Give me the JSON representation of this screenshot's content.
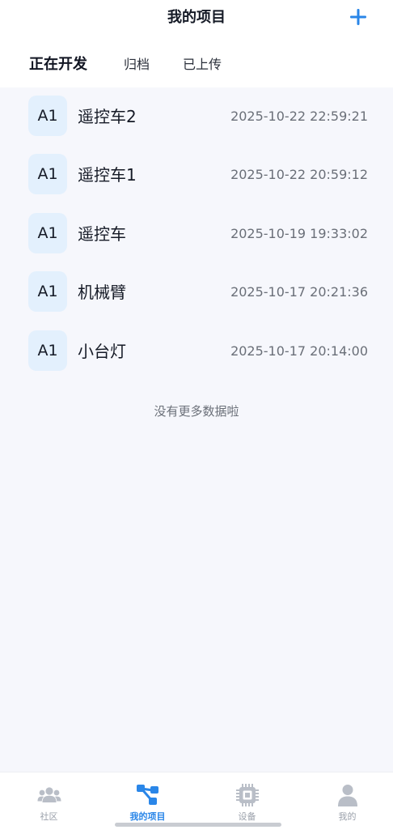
{
  "header": {
    "title": "我的项目",
    "add_icon": "plus-icon",
    "accent": "#2a86e8"
  },
  "tabs": [
    {
      "label": "正在开发",
      "active": true
    },
    {
      "label": "归档",
      "active": false
    },
    {
      "label": "已上传",
      "active": false
    }
  ],
  "projects": [
    {
      "badge": "A1",
      "name": "遥控车2",
      "date": "2025-10-22 22:59:21"
    },
    {
      "badge": "A1",
      "name": "遥控车1",
      "date": "2025-10-22 20:59:12"
    },
    {
      "badge": "A1",
      "name": "遥控车",
      "date": "2025-10-19 19:33:02"
    },
    {
      "badge": "A1",
      "name": "机械臂",
      "date": "2025-10-17 20:21:36"
    },
    {
      "badge": "A1",
      "name": "小台灯",
      "date": "2025-10-17 20:14:00"
    }
  ],
  "no_more_text": "没有更多数据啦",
  "bottom_nav": [
    {
      "label": "社区",
      "icon": "users-icon",
      "active": false
    },
    {
      "label": "我的项目",
      "icon": "project-flow-icon",
      "active": true
    },
    {
      "label": "设备",
      "icon": "chip-icon",
      "active": false
    },
    {
      "label": "我的",
      "icon": "person-icon",
      "active": false
    }
  ]
}
